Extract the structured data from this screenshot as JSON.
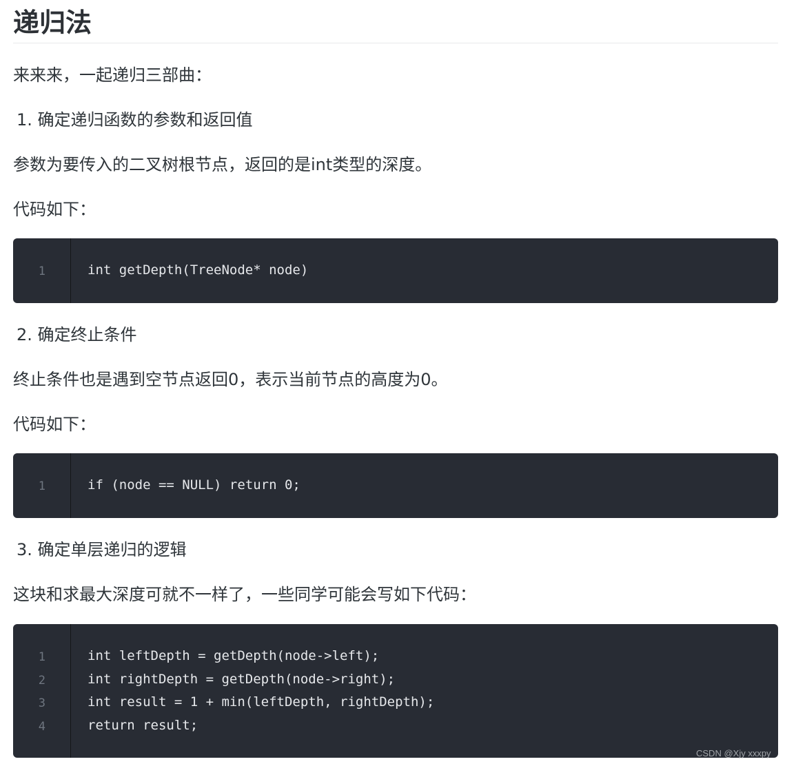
{
  "heading": "递归法",
  "intro": "来来来，一起递归三部曲：",
  "step1": "1. 确定递归函数的参数和返回值",
  "step1_desc": "参数为要传入的二叉树根节点，返回的是int类型的深度。",
  "code_intro_1": "代码如下：",
  "code_block_1": {
    "line_numbers": [
      "1"
    ],
    "lines": [
      "int getDepth(TreeNode* node)"
    ]
  },
  "step2": "2. 确定终止条件",
  "step2_desc": "终止条件也是遇到空节点返回0，表示当前节点的高度为0。",
  "code_intro_2": "代码如下：",
  "code_block_2": {
    "line_numbers": [
      "1"
    ],
    "lines": [
      "if (node == NULL) return 0;"
    ]
  },
  "step3": "3. 确定单层递归的逻辑",
  "step3_desc": "这块和求最大深度可就不一样了，一些同学可能会写如下代码：",
  "code_block_3": {
    "line_numbers": [
      "1",
      "2",
      "3",
      "4"
    ],
    "lines": [
      "int leftDepth = getDepth(node->left);",
      "int rightDepth = getDepth(node->right);",
      "int result = 1 + min(leftDepth, rightDepth);",
      "return result;"
    ]
  },
  "watermark": "CSDN @Xjy xxxpy"
}
